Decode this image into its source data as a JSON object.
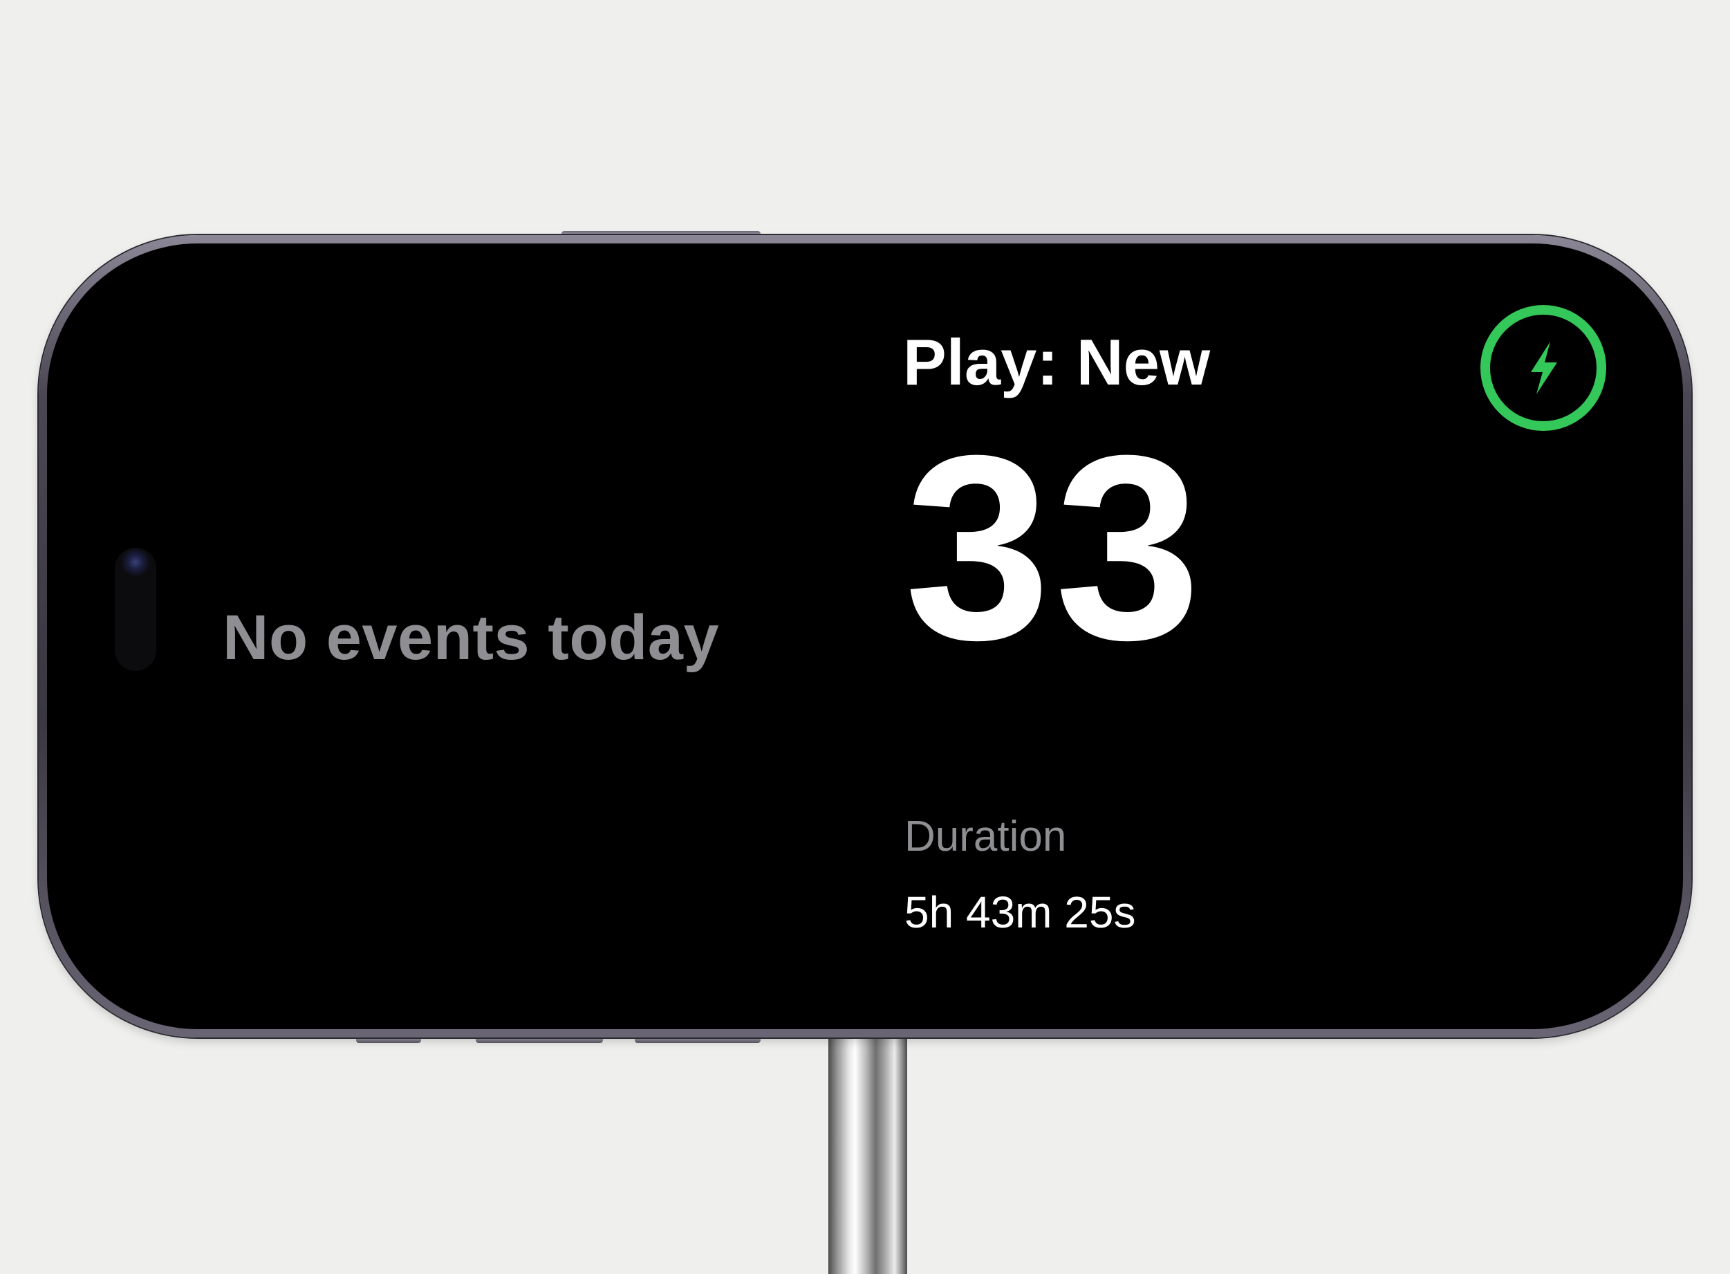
{
  "standby": {
    "events_text": "No events today",
    "widget_title": "Play: New",
    "count": "33",
    "duration_label": "Duration",
    "duration_value": "5h 43m 25s",
    "charging_icon": "bolt-icon"
  },
  "colors": {
    "background": "#eff0ee",
    "screen": "#000000",
    "primary_text": "#ffffff",
    "secondary_text": "#8e8e93",
    "charging_accent": "#34c759"
  }
}
